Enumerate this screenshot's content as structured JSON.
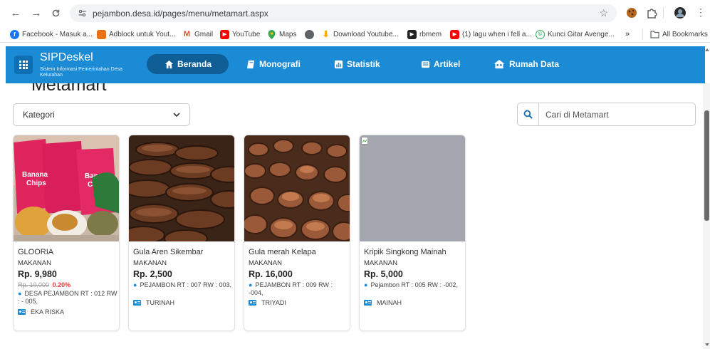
{
  "browser": {
    "url": "pejambon.desa.id/pages/menu/metamart.aspx",
    "bookmarks": [
      {
        "label": "Facebook - Masuk a...",
        "icon": "facebook-icon",
        "color": "#1877f2"
      },
      {
        "label": "Adblock untuk Yout...",
        "icon": "adblock-icon",
        "color": "#e8711a"
      },
      {
        "label": "Gmail",
        "icon": "gmail-icon",
        "color": "#ea4335"
      },
      {
        "label": "YouTube",
        "icon": "youtube-icon",
        "color": "#ff0000"
      },
      {
        "label": "Maps",
        "icon": "maps-icon",
        "color": "#34a853"
      },
      {
        "label": "",
        "icon": "globe-icon",
        "color": "#5f6368"
      },
      {
        "label": "Download Youtube...",
        "icon": "download-icon",
        "color": "#f9ab00"
      },
      {
        "label": "rbmem",
        "icon": "rbmem-icon",
        "color": "#202124"
      },
      {
        "label": "(1) lagu when i fell a...",
        "icon": "youtube-icon",
        "color": "#ff0000"
      },
      {
        "label": "Kunci Gitar Avenge...",
        "icon": "chord-icon",
        "color": "#34a853"
      }
    ],
    "more_label": "»",
    "all_bookmarks": "All Bookmarks"
  },
  "header": {
    "title": "SIPDeskel",
    "subtitle": "Sistem Informasi Pemerintahan Desa Kelurahan",
    "menu": [
      {
        "label": "Beranda",
        "icon": "home-icon",
        "active": true
      },
      {
        "label": "Monografi",
        "icon": "book-icon",
        "active": false
      },
      {
        "label": "Statistik",
        "icon": "chart-icon",
        "active": false
      },
      {
        "label": "Artikel",
        "icon": "newspaper-icon",
        "active": false
      },
      {
        "label": "Rumah Data",
        "icon": "people-icon",
        "active": false
      }
    ],
    "accent": "#1b8bd5"
  },
  "page": {
    "title": "Metamart",
    "category_label": "Kategori",
    "search_placeholder": "Cari di Metamart"
  },
  "products": [
    {
      "name": "GLOORIA",
      "category": "MAKANAN",
      "price": "Rp. 9,980",
      "old_price": "Rp. 10,000",
      "discount": "0.20%",
      "address": "DESA PEJAMBON RT : 012 RW : - 005,",
      "seller": "EKA RISKA"
    },
    {
      "name": "Gula Aren Sikembar",
      "category": "MAKANAN",
      "price": "Rp. 2,500",
      "address": "PEJAMBON RT : 007 RW : 003,",
      "seller": "TURINAH"
    },
    {
      "name": "Gula merah Kelapa",
      "category": "MAKANAN",
      "price": "Rp. 16,000",
      "address": "PEJAMBON RT : 009 RW : -004,",
      "seller": "TRIYADI"
    },
    {
      "name": "Kripik Singkong Mainah",
      "category": "MAKANAN",
      "price": "Rp. 5,000",
      "address": "Pejambon RT : 005 RW : -002,",
      "seller": "MAINAH"
    }
  ]
}
